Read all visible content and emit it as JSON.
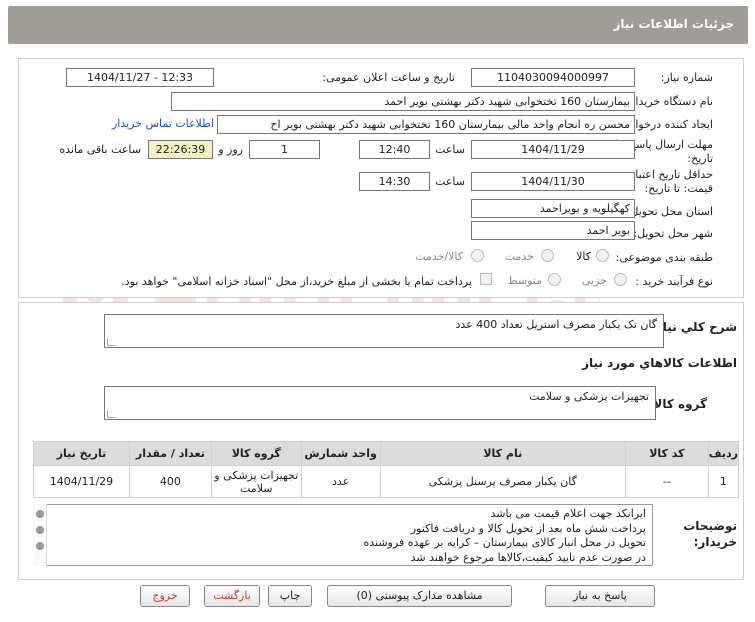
{
  "header": {
    "title": "جزئیات اطلاعات نیاز"
  },
  "form": {
    "need_number_label": "شماره نیاز:",
    "need_number": "1104030094000997",
    "announce_label": "تاریخ و ساعت اعلان عمومی:",
    "announce_value": "1404/11/27 - 12:33",
    "buyer_org_label": "نام دستگاه خریدار:",
    "buyer_org": "بیمارستان 160 تختخوابی شهید دکتر بهشتی بویر احمد",
    "requester_label": "ایجاد کننده درخواست:",
    "requester": "محسن ره انجام واحد مالی بیمارستان 160 تختخوابی شهید دکتر بهشتی بویر اح",
    "contact_link": "اطلاعات تماس خریدار",
    "deadline_label_1": "مهلت ارسال پاسخ: تا",
    "deadline_label_2": "تاریخ:",
    "deadline_date": "1404/11/29",
    "time_word": "ساعت",
    "deadline_time": "12:40",
    "days_value": "1",
    "days_word": "روز و",
    "remaining_time": "22:26:39",
    "remaining_word": "ساعت باقی مانده",
    "validity_label_1": "حداقل تاریخ اعتبار",
    "validity_label_2": "قیمت: تا تاریخ:",
    "validity_date": "1404/11/30",
    "validity_time": "14:30",
    "province_label": "استان محل تحویل:",
    "province": "کهگیلویه و بویراحمد",
    "city_label": "شهر محل تحویل:",
    "city": "بویر احمد",
    "category_label": "طبقه بندی موضوعی:",
    "category_options": [
      "کالا",
      "خدمت",
      "کالا/خدمت"
    ],
    "process_label": "نوع فرآیند خرید :",
    "process_options": [
      "جزیی",
      "متوسط"
    ],
    "payment_note": "پرداخت تمام یا بخشی از مبلغ خرید،از محل \"اسناد خزانه اسلامی\" خواهد بود."
  },
  "summary": {
    "label": "شرح کلي نياز:",
    "value": "گان تک یکبار مصرف استریل تعداد 400 عدد"
  },
  "goods_info_title": "اطلاعات کالاهاي مورد نياز",
  "goods_group": {
    "label": "گروه کالا:",
    "value": "تجهیزات پزشکی و سلامت"
  },
  "table": {
    "headers": [
      "ردیف",
      "کد کالا",
      "نام کالا",
      "واحد شمارش",
      "گروه کالا",
      "تعداد / مقدار",
      "تاریخ نیاز"
    ],
    "rows": [
      [
        "1",
        "--",
        "گان یکبار مصرف پرسنل پزشکی",
        "عدد",
        "تجهیزات پزشکی و سلامت",
        "400",
        "1404/11/29"
      ]
    ]
  },
  "buyer_notes": {
    "label_1": "توضیحات",
    "label_2": "خریدار:",
    "lines": [
      "ایرانکد جهت اعلام قیمت می باشد",
      "پرداخت شش ماه بعد از تحویل کالا و دریافت فاکتور",
      "تحویل در محل انبار کالای بیمارستان – کرایه بر عهده فروشنده",
      "در صورت عدم تایید کیفیت،کالاها مرجوع خواهند شد"
    ]
  },
  "buttons": {
    "reply": "پاسخ به نیاز",
    "attachments": "مشاهده مدارک پیوستی (0)",
    "print": "چاپ",
    "back": "بازگشت",
    "exit": "خروج"
  },
  "watermark_text": "AriaTender.net",
  "colors": {
    "header": "#a09c98",
    "link": "#1a4fb3",
    "timer_bg": "#f5f0c2",
    "exit_red": "#c0392b"
  }
}
